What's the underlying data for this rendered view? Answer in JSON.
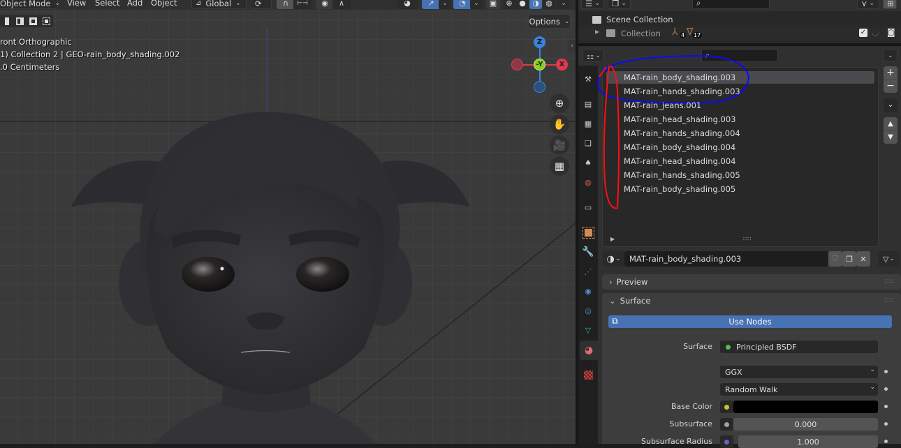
{
  "viewport": {
    "header": {
      "mode": "Object Mode",
      "menus": [
        "View",
        "Select",
        "Add",
        "Object"
      ],
      "orientation": "Global",
      "options_label": "Options"
    },
    "overlay": {
      "view_name": "ront Orthographic",
      "object_info": "1) Collection 2 | GEO-rain_body_shading.002",
      "scale": ".0 Centimeters"
    },
    "gizmo": {
      "z_label": "Z",
      "y_label": "-Y",
      "x_label": "X",
      "colors": {
        "x": "#e2394f",
        "y": "#8bce1f",
        "z": "#3a82d6"
      }
    },
    "nav_buttons": [
      "zoom-icon",
      "hand-pan-icon",
      "camera-icon",
      "grid-icon"
    ]
  },
  "outliner": {
    "search_placeholder": "",
    "scene_collection_label": "Scene Collection",
    "collection_label": "Collection",
    "armature_count": "4",
    "mesh_count": "17"
  },
  "properties": {
    "search_placeholder": "",
    "material_slots": [
      "MAT-rain_body_shading.003",
      "MAT-rain_hands_shading.003",
      "MAT-rain_jeans.001",
      "MAT-rain_head_shading.003",
      "MAT-rain_hands_shading.004",
      "MAT-rain_body_shading.004",
      "MAT-rain_head_shading.004",
      "MAT-rain_hands_shading.005",
      "MAT-rain_body_shading.005"
    ],
    "active_slot_index": 0,
    "material_name": "MAT-rain_body_shading.003",
    "panels": {
      "preview_label": "Preview",
      "surface_label": "Surface"
    },
    "use_nodes_label": "Use Nodes",
    "surface": {
      "surface_label": "Surface",
      "surface_value": "Principled BSDF",
      "distribution": "GGX",
      "subsurface_method": "Random Walk",
      "base_color_label": "Base Color",
      "base_color": "#000000",
      "subsurface_label": "Subsurface",
      "subsurface_value": "0.000",
      "subsurface_radius_label": "Subsurface Radius",
      "subsurface_radius_value": "1.000"
    },
    "accent_color": "#4772b3"
  },
  "annotations": {
    "blue_circle_color": "#0000ff",
    "red_loop_color": "#ff0000"
  }
}
